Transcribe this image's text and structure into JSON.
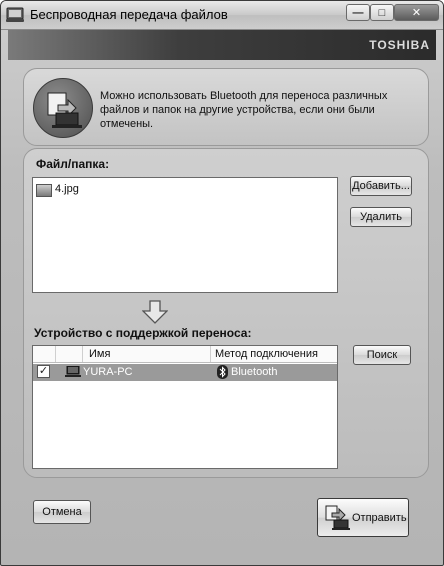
{
  "window": {
    "title": "Беспроводная передача файлов",
    "brand": "TOSHIBA",
    "controls": {
      "minimize": "—",
      "maximize": "□",
      "close": "✕"
    }
  },
  "info": {
    "text": "Можно использовать Bluetooth для переноса различных файлов и папок на другие устройства, если они были отмечены."
  },
  "files": {
    "label": "Файл/папка:",
    "items": [
      {
        "name": "4.jpg"
      }
    ],
    "add_button": "Добавить...",
    "remove_button": "Удалить"
  },
  "devices": {
    "label": "Устройство с поддержкой переноса:",
    "columns": {
      "name": "Имя",
      "method": "Метод подключения"
    },
    "rows": [
      {
        "checked": true,
        "check_mark": "✓",
        "name": "YURA-PC",
        "method": "Bluetooth"
      }
    ],
    "search_button": "Поиск"
  },
  "footer": {
    "cancel_button": "Отмена",
    "send_button": "Отправить"
  }
}
